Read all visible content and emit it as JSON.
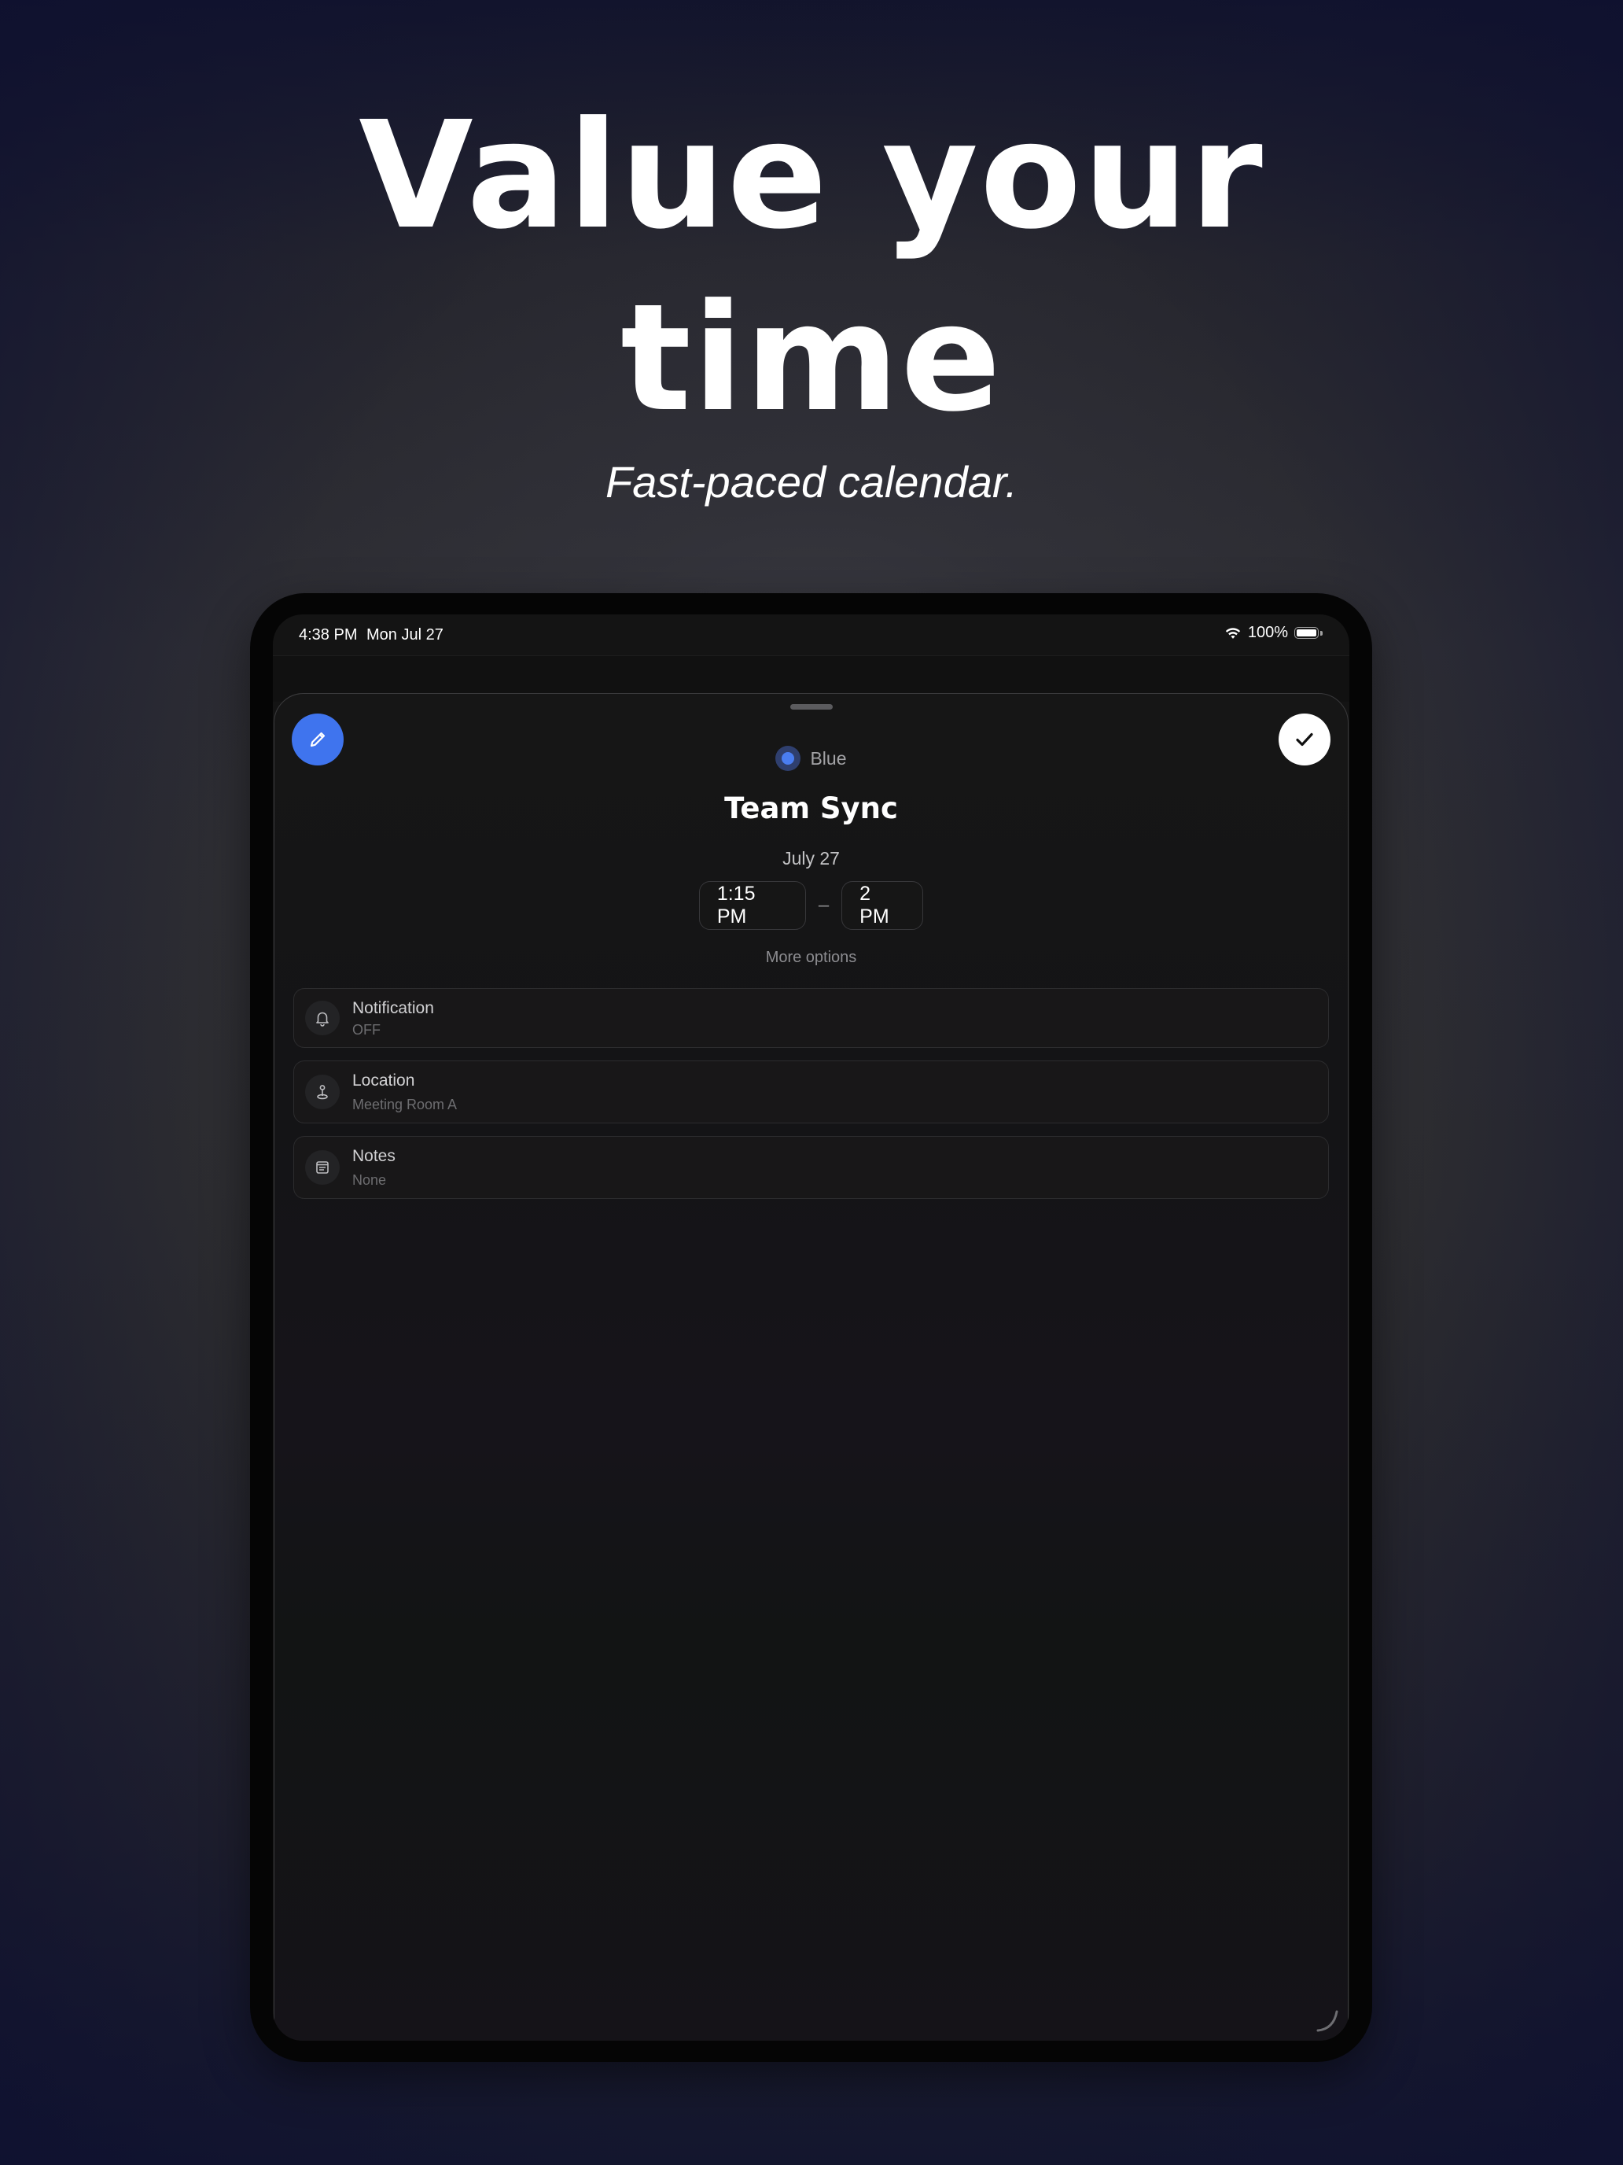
{
  "hero": {
    "headline_line1": "Value your",
    "headline_line2": "time",
    "subtitle": "Fast-paced calendar."
  },
  "status_bar": {
    "time": "4:38 PM",
    "date": "Mon Jul 27",
    "battery": "100%",
    "icons": [
      "wifi-icon",
      "battery-icon"
    ]
  },
  "event_sheet": {
    "color": {
      "label": "Blue",
      "value": "#4a7df0"
    },
    "title": "Team Sync",
    "date": "July 27",
    "start_time": "1:15 PM",
    "separator": "–",
    "end_time": "2 PM",
    "more_options": "More options",
    "options": [
      {
        "icon": "bell-icon",
        "label": "Notification",
        "value": "OFF"
      },
      {
        "icon": "location-pin-icon",
        "label": "Location",
        "value": "Meeting Room A"
      },
      {
        "icon": "notes-icon",
        "label": "Notes",
        "value": "None"
      }
    ],
    "actions": {
      "edit_icon": "pencil-icon",
      "done_icon": "checkmark-icon"
    }
  },
  "colors": {
    "accent": "#3f74ee",
    "sheet_background": "#141414",
    "device_frame": "#050505"
  }
}
